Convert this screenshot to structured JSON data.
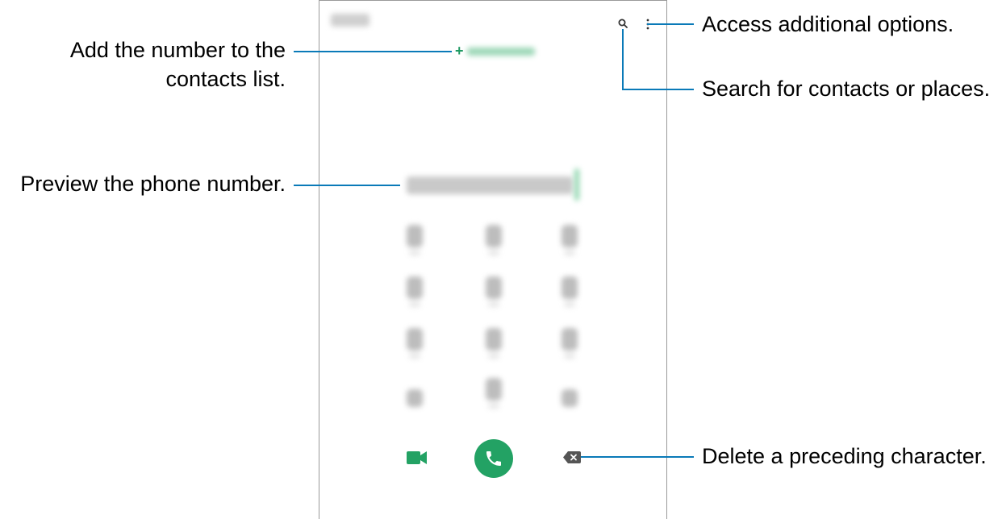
{
  "callouts": {
    "add_number": "Add the number to the contacts list.",
    "add_number_line1": "Add the number to the",
    "add_number_line2": "contacts list.",
    "preview": "Preview the phone number.",
    "more_options": "Access additional options.",
    "search": "Search for contacts or places.",
    "delete": "Delete a preceding character."
  },
  "phone": {
    "header": {
      "search_icon": "search-icon",
      "more_icon": "more-options-icon"
    },
    "add_to_contacts": {
      "icon": "plus-icon"
    },
    "keypad": {
      "rows": 4,
      "cols": 3
    },
    "bottom_bar": {
      "video_icon": "video-call-icon",
      "call_icon": "phone-icon",
      "delete_icon": "backspace-icon"
    }
  },
  "colors": {
    "accent_green": "#23a264",
    "callout_line": "#0a7ab8",
    "frame": "#9a9a9a"
  }
}
